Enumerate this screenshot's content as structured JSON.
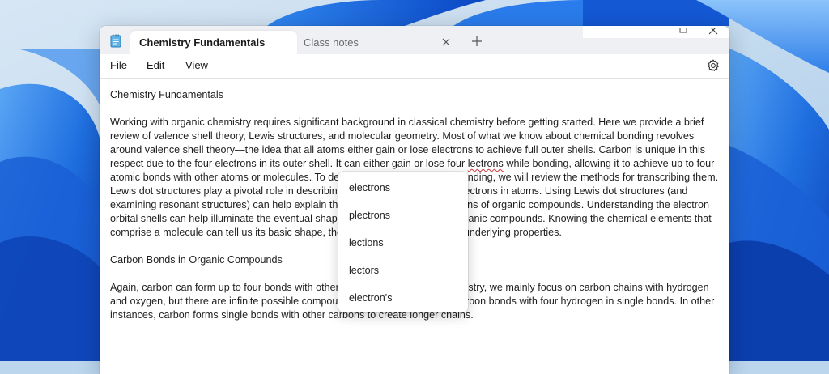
{
  "window": {
    "tabs": [
      {
        "label": "Chemistry Fundamentals",
        "active": true
      },
      {
        "label": "Class notes",
        "active": false
      }
    ]
  },
  "menu": {
    "file": "File",
    "edit": "Edit",
    "view": "View"
  },
  "document": {
    "heading1": "Chemistry Fundamentals",
    "para1_before": "Working with organic chemistry requires significant background in classical chemistry before getting started. Here we provide a brief review of valence shell theory, Lewis structures, and molecular geometry. Most of what we know about chemical bonding revolves around valence shell theory—the idea that all atoms either gain or lose electrons to achieve full outer shells. Carbon is unique in this respect due to the four electrons in its outer shell. It can either gain or lose four ",
    "misspelled_word": "lectrons",
    "para1_after": " while bonding, allowing it to achieve up to four atomic bonds with other atoms or molecules. To describe organic molecules' bonding, we will review the methods for transcribing them. Lewis dot structures play a pivotal role in describing the paired and unpaired electrons in atoms. Using Lewis dot structures (and examining resonant structures) can help explain the shapes and bonding patterns of organic compounds. Understanding the electron orbital shells can help illuminate the eventual shapes and resulting bonds in organic compounds. Knowing the chemical elements that comprise a molecule can tell us its basic shape, the angle of its bonds, and its underlying properties.",
    "heading2": "Carbon Bonds in Organic Compounds",
    "para2": "Again, carbon can form up to four bonds with other molecules. In organic chemistry, we mainly focus on carbon chains with hydrogen and oxygen, but there are infinite possible compounds. In the simplest form, carbon bonds with four hydrogen in single bonds. In other instances, carbon forms single bonds with other carbons to create longer chains."
  },
  "spelling_suggestions": [
    "electrons",
    "plectrons",
    "lections",
    "lectors",
    "electron's"
  ],
  "colors": {
    "accent": "#1f6fd6",
    "squiggle": "#d13438"
  }
}
